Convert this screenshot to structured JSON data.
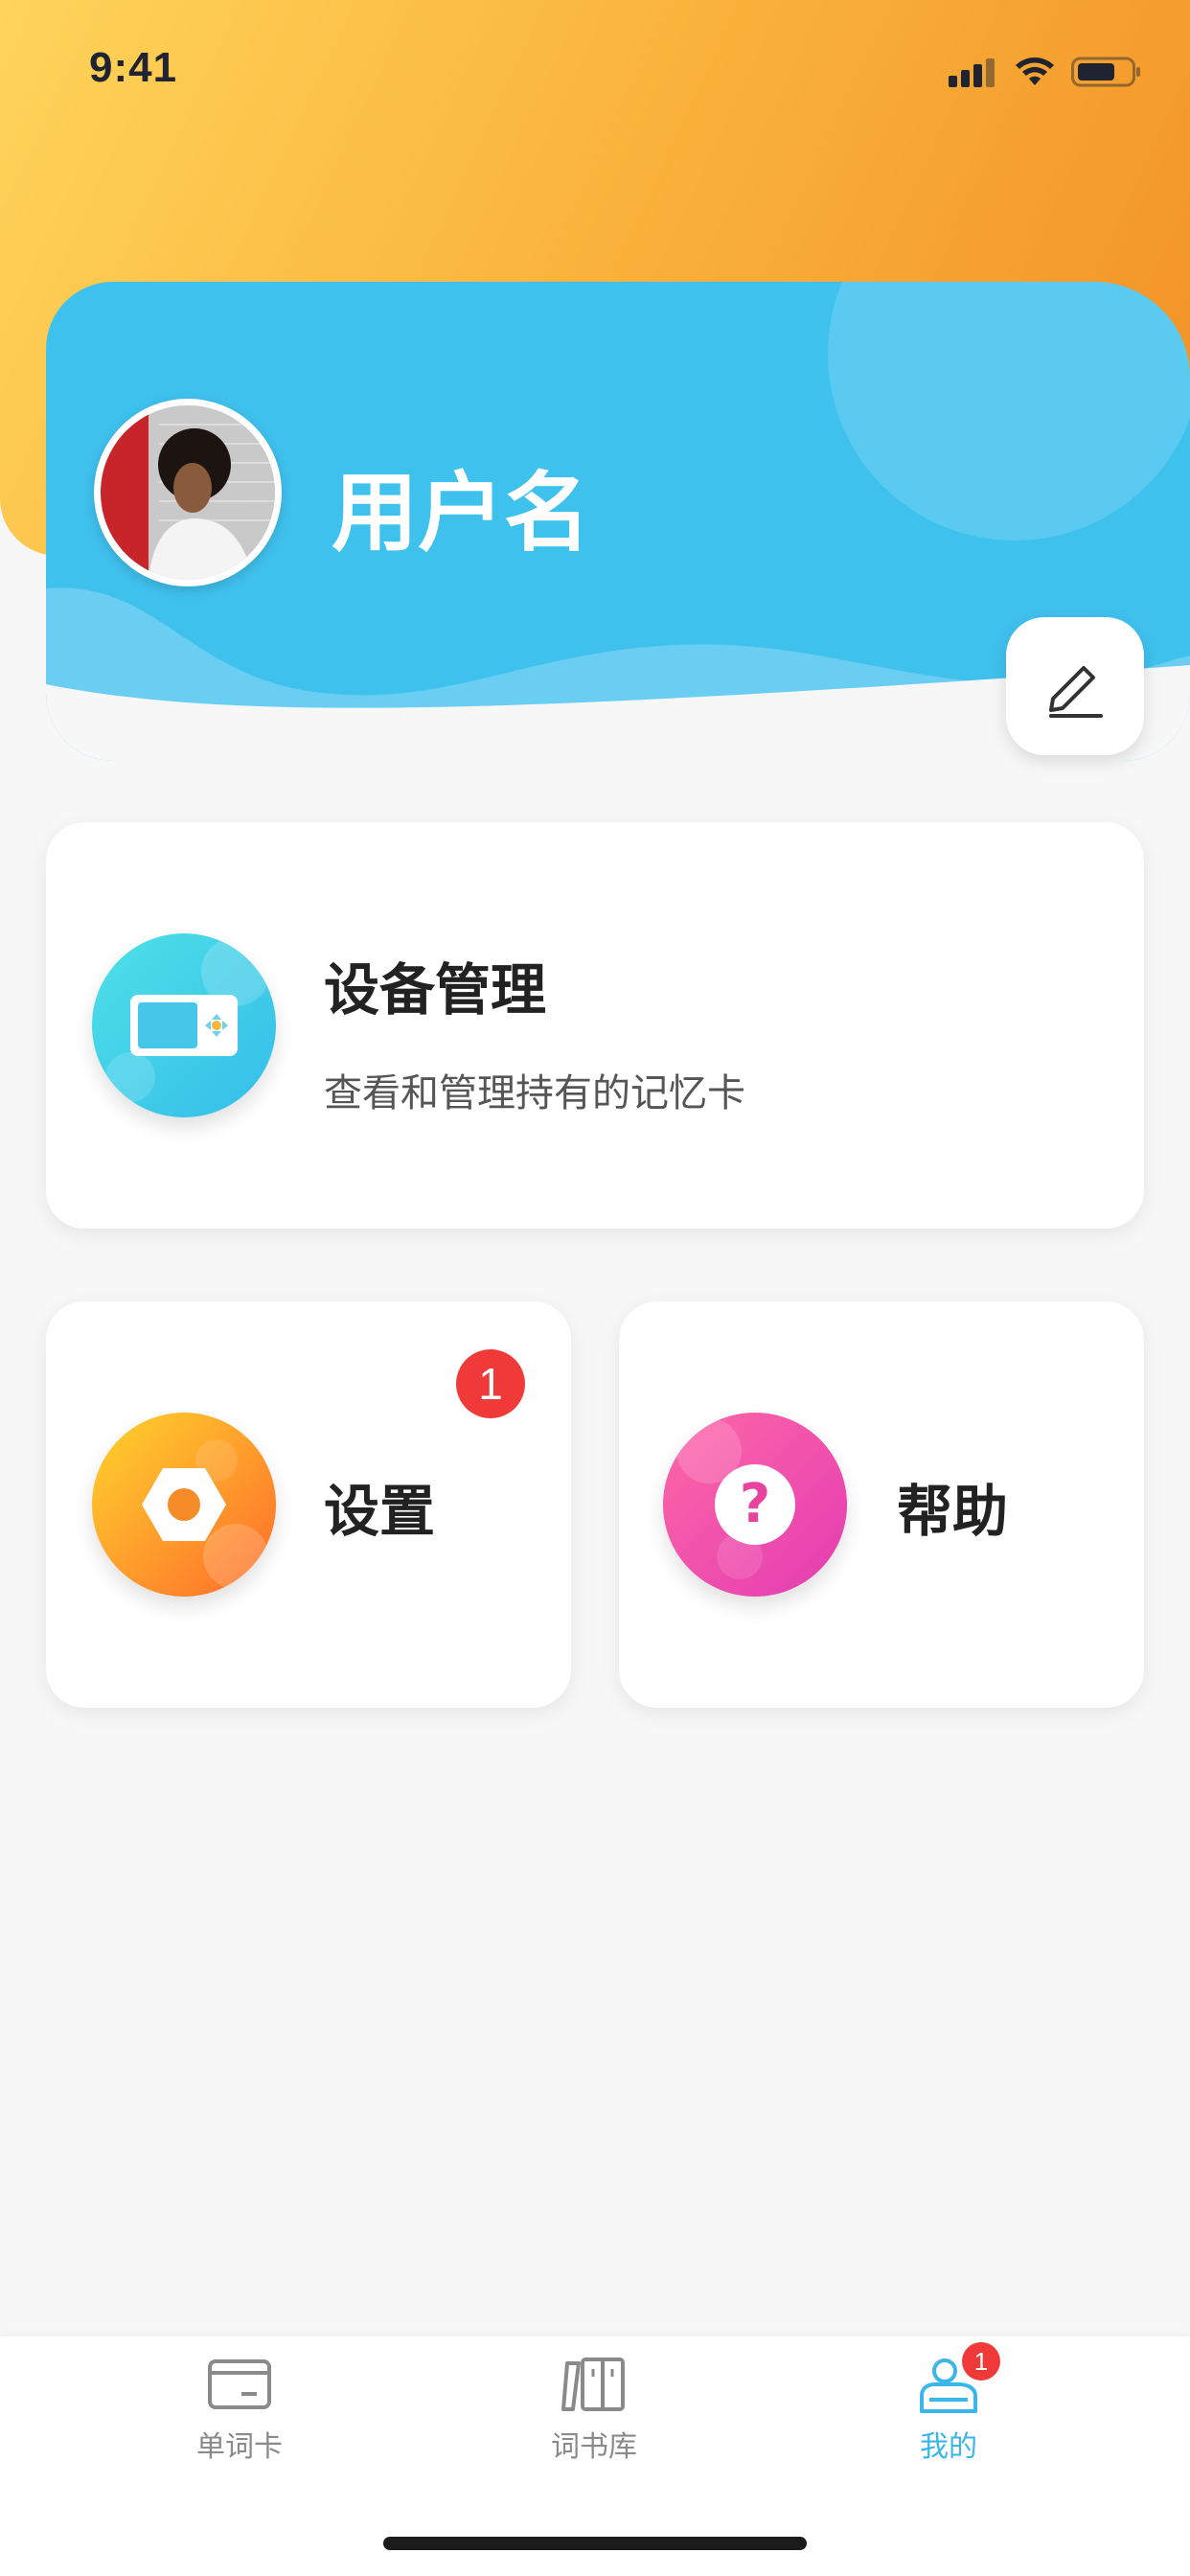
{
  "status_bar": {
    "time": "9:41"
  },
  "profile": {
    "username": "用户名"
  },
  "cards": {
    "device": {
      "title": "设备管理",
      "subtitle": "查看和管理持有的记忆卡"
    },
    "settings": {
      "title": "设置",
      "badge": "1"
    },
    "help": {
      "title": "帮助"
    }
  },
  "tabbar": {
    "tabs": [
      {
        "label": "单词卡",
        "icon": "card-icon",
        "active": false
      },
      {
        "label": "词书库",
        "icon": "library-icon",
        "active": false
      },
      {
        "label": "我的",
        "icon": "profile-icon",
        "active": true,
        "badge": "1"
      }
    ],
    "active_color": "#3ab6ea",
    "inactive_color": "#8a8a8a"
  },
  "colors": {
    "header_gradient": [
      "#ffd45a",
      "#f29126"
    ],
    "profile_card": "#3fc1ee",
    "badge": "#f03a3a"
  }
}
